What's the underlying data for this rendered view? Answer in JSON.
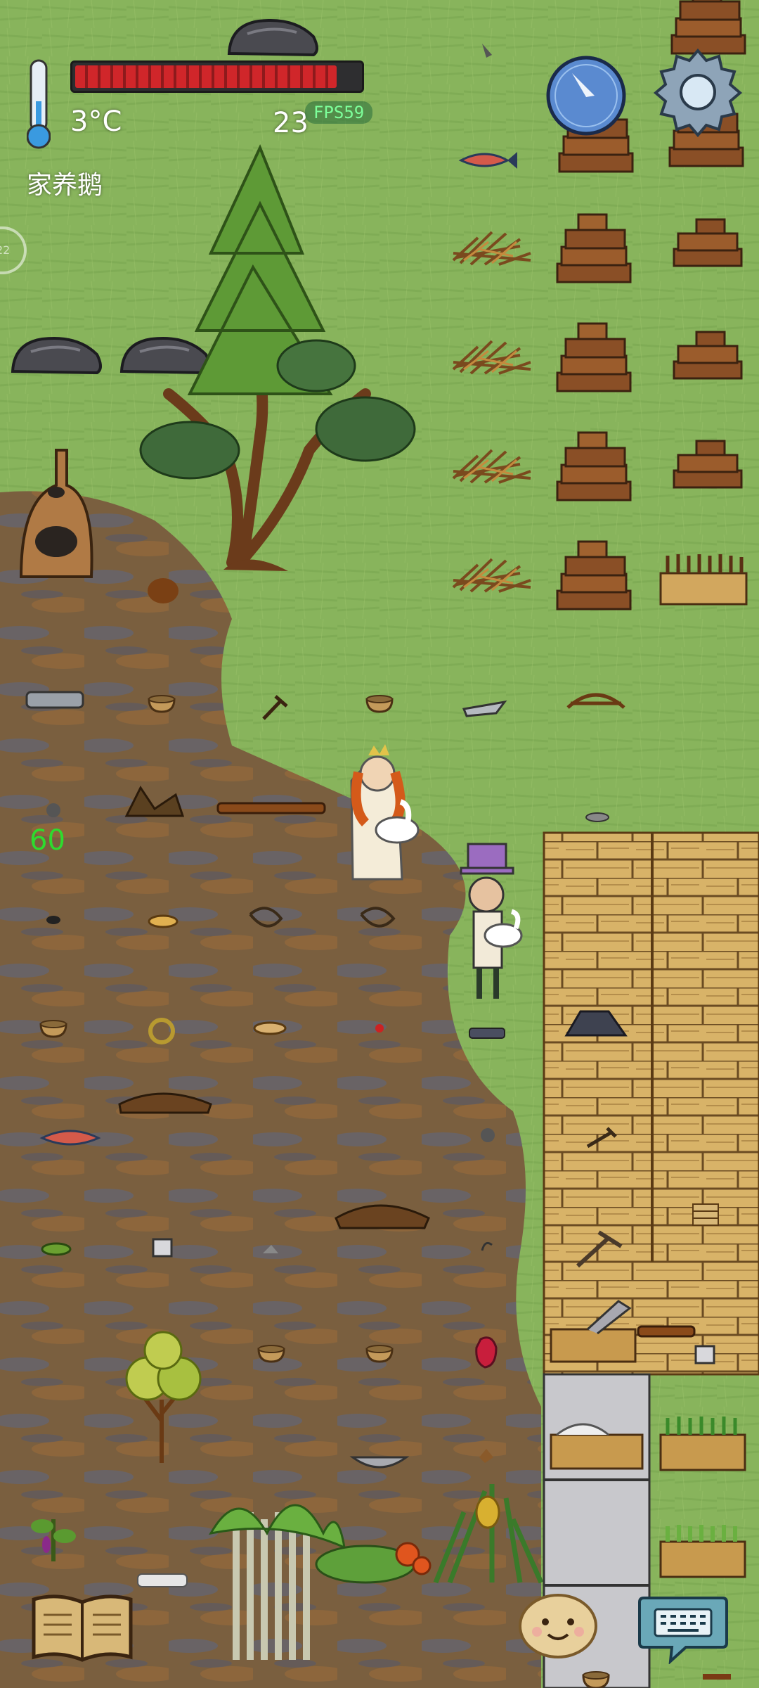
{
  "hud": {
    "temperature": "3°C",
    "held_item_name": "家养鹅",
    "age": "23",
    "fps": "FPS59",
    "ping_value": "22",
    "hunger_fraction": 0.92
  },
  "world": {
    "floating_number": "60"
  },
  "icons": {
    "thermometer": "thermometer-icon",
    "compass": "compass-icon",
    "settings": "gear-icon",
    "recipe_book": "book-icon",
    "emote": "potato-face-icon",
    "keyboard": "keyboard-icon"
  },
  "colors": {
    "hunger_bar": "#d0262a",
    "floating_number": "#2edb2e",
    "fps_text": "#7dff9a"
  }
}
